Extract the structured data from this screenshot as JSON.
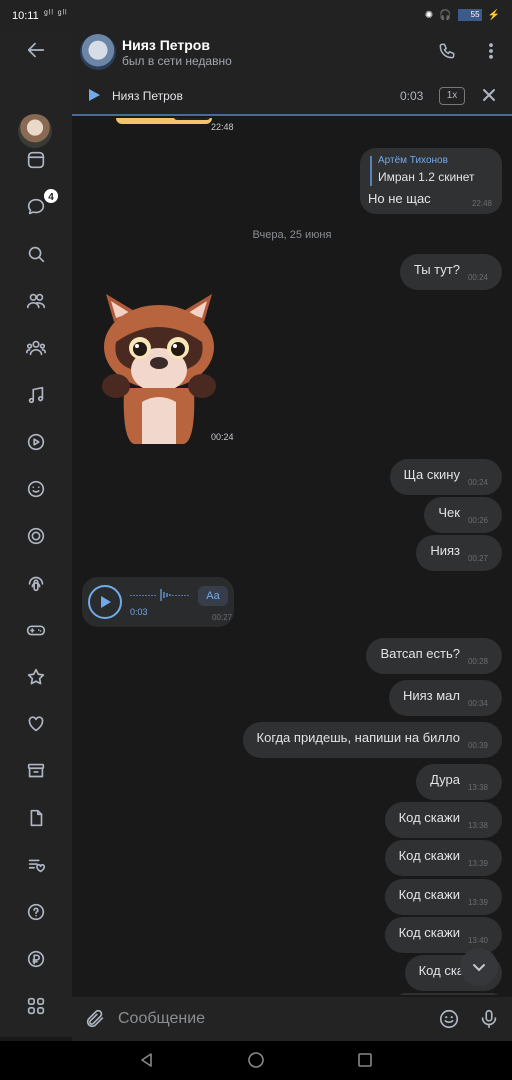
{
  "status_bar": {
    "time": "10:11",
    "network": "ᵍˡˡ ᵍˡˡ",
    "battery": "55"
  },
  "sidebar": {
    "unread_badge": "4",
    "items": [
      {
        "icon": "back-arrow-icon"
      },
      {
        "icon": "profile-avatar"
      },
      {
        "icon": "news-icon"
      },
      {
        "icon": "messages-icon"
      },
      {
        "icon": "search-icon"
      },
      {
        "icon": "friends-icon"
      },
      {
        "icon": "communities-icon"
      },
      {
        "icon": "music-icon"
      },
      {
        "icon": "video-icon"
      },
      {
        "icon": "emoji-icon"
      },
      {
        "icon": "target-icon"
      },
      {
        "icon": "podcast-icon"
      },
      {
        "icon": "games-icon"
      },
      {
        "icon": "star-icon"
      },
      {
        "icon": "heart-icon"
      },
      {
        "icon": "archive-icon"
      },
      {
        "icon": "document-icon"
      },
      {
        "icon": "wishlist-icon"
      },
      {
        "icon": "help-icon"
      },
      {
        "icon": "payments-icon"
      },
      {
        "icon": "services-icon"
      }
    ]
  },
  "header": {
    "name": "Нияз Петров",
    "status": "был в сети недавно"
  },
  "player": {
    "track": "Нияз Петров",
    "time": "0:03",
    "speed": "1x"
  },
  "chat": {
    "sticker1_time": "22:48",
    "reply": {
      "author": "Артём Тихонов",
      "quote": "Имран 1.2 скинет",
      "text": "Но не щас",
      "time": "22:48"
    },
    "date_separator": "Вчера, 25 июня",
    "msg_tytut": {
      "text": "Ты тут?",
      "time": "00:24"
    },
    "sticker2_time": "00:24",
    "msg_scinu": {
      "text": "Ща скину",
      "time": "00:24"
    },
    "msg_chek": {
      "text": "Чек",
      "time": "00:26"
    },
    "msg_niyaz": {
      "text": "Нияз",
      "time": "00:27"
    },
    "voice": {
      "duration": "0:03",
      "transcribe": "Aa",
      "time": "00:27"
    },
    "msg_watsap": {
      "text": "Ватсап есть?",
      "time": "00:28"
    },
    "msg_niyazmal": {
      "text": "Нияз мал",
      "time": "00:34"
    },
    "msg_pridesh": {
      "text": "Когда придешь, напиши на билло",
      "time": "00:39"
    },
    "msg_dura": {
      "text": "Дура",
      "time": "13:38"
    },
    "msg_kod1": {
      "text": "Код скажи",
      "time": "13:38"
    },
    "msg_kod2": {
      "text": "Код скажи",
      "time": "13:39"
    },
    "msg_kod3": {
      "text": "Код скажи",
      "time": "13:39"
    },
    "msg_kod4": {
      "text": "Код скажи",
      "time": "13:40"
    },
    "msg_kod5": {
      "text": "Код скажи",
      "time": ""
    }
  },
  "composer": {
    "placeholder": "Сообщение"
  }
}
